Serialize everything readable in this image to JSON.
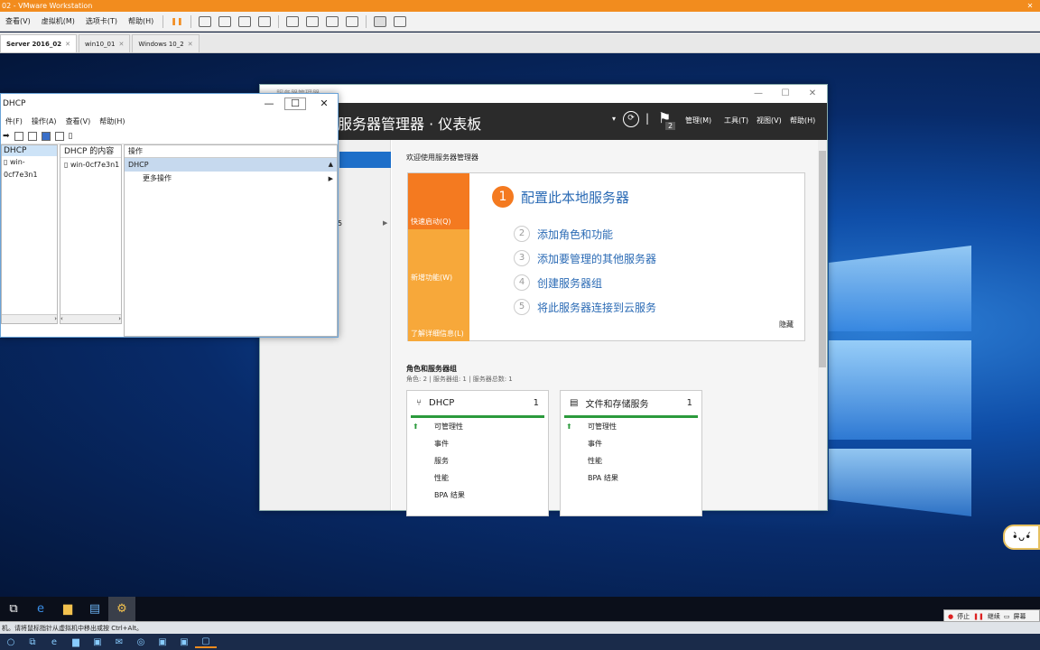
{
  "vmware": {
    "title": "02 - VMware Workstation",
    "menu": [
      "查看(V)",
      "虚拟机(M)",
      "选项卡(T)",
      "帮助(H)"
    ],
    "tabs": [
      "Server 2016_02",
      "win10_01",
      "Windows 10_2"
    ],
    "status": "机。请将鼠标指针从虚拟机中移出或按 Ctrl+Alt。",
    "controls": [
      "停止",
      "继续",
      "屏幕"
    ]
  },
  "dhcp": {
    "title": "DHCP",
    "menu": [
      "件(F)",
      "操作(A)",
      "查看(V)",
      "帮助(H)"
    ],
    "tree_root": "DHCP",
    "tree_server": "win-0cf7e3n1",
    "content_header": "DHCP 的内容",
    "content_item": "win-0cf7e3n1",
    "actions_header": "操作",
    "actions_selected": "DHCP",
    "actions_more": "更多操作"
  },
  "sm": {
    "title": "服务器管理器",
    "breadcrumb": "服务器管理器 · 仪表板",
    "header_menu": [
      "管理(M)",
      "工具(T)",
      "视图(V)",
      "帮助(H)"
    ],
    "flag_count": "2",
    "nav_partial": "5",
    "welcome": "欢迎使用服务器管理器",
    "quick_start": "快速启动(Q)",
    "whats_new": "新增功能(W)",
    "learn_more": "了解详细信息(L)",
    "step1": "配置此本地服务器",
    "steps": [
      {
        "n": "2",
        "t": "添加角色和功能"
      },
      {
        "n": "3",
        "t": "添加要管理的其他服务器"
      },
      {
        "n": "4",
        "t": "创建服务器组"
      },
      {
        "n": "5",
        "t": "将此服务器连接到云服务"
      }
    ],
    "hide": "隐藏",
    "roles_title": "角色和服务器组",
    "roles_sub": "角色: 2 | 服务器组: 1 | 服务器总数: 1",
    "cards": [
      {
        "name": "DHCP",
        "count": "1",
        "rows": [
          "可管理性",
          "事件",
          "服务",
          "性能",
          "BPA 结果"
        ]
      },
      {
        "name": "文件和存储服务",
        "count": "1",
        "rows": [
          "可管理性",
          "事件",
          "性能",
          "BPA 结果"
        ]
      }
    ]
  },
  "colors": {
    "accent": "#f28c1e",
    "qs1": "#f47a20",
    "qs2": "#f7a83a",
    "green": "#2b9a3c",
    "link": "#2b6bb5"
  }
}
